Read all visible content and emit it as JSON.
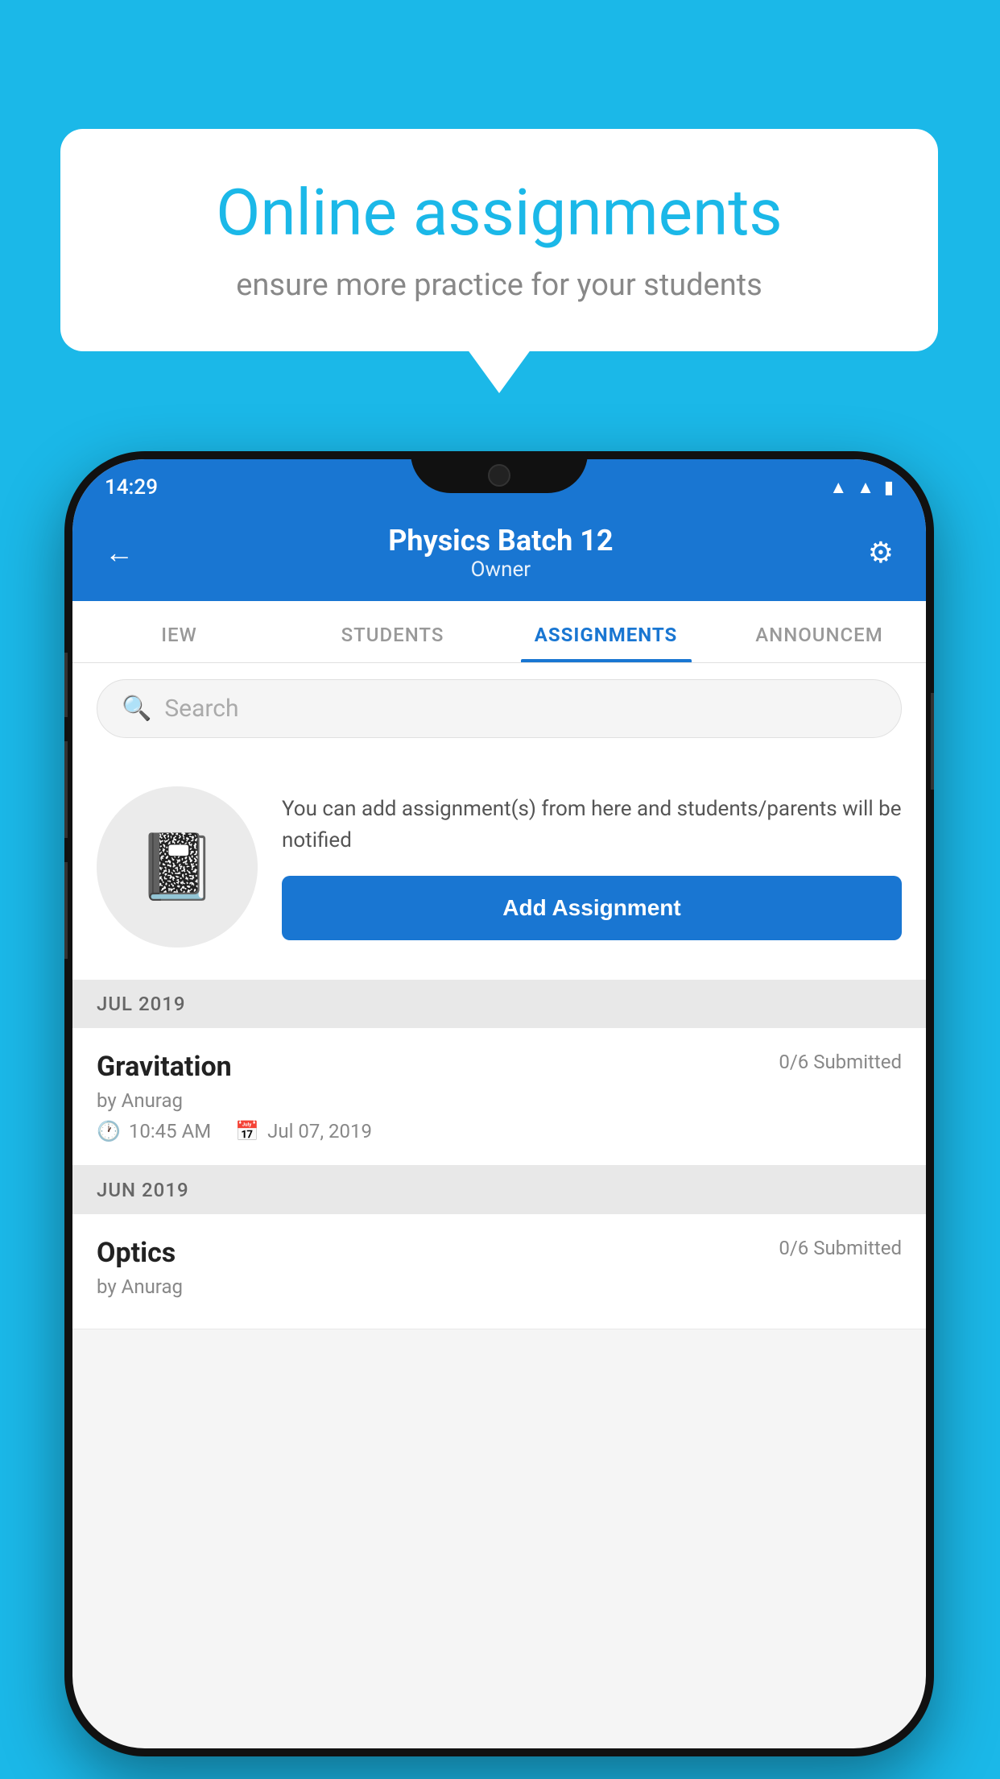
{
  "background": {
    "color": "#1bb8e8"
  },
  "speech_bubble": {
    "title": "Online assignments",
    "subtitle": "ensure more practice for your students"
  },
  "phone": {
    "status_bar": {
      "time": "14:29",
      "icons": [
        "wifi",
        "signal",
        "battery"
      ]
    },
    "header": {
      "back_label": "←",
      "title": "Physics Batch 12",
      "subtitle": "Owner",
      "settings_label": "⚙"
    },
    "tabs": [
      {
        "label": "IEW",
        "active": false
      },
      {
        "label": "STUDENTS",
        "active": false
      },
      {
        "label": "ASSIGNMENTS",
        "active": true
      },
      {
        "label": "ANNOUNCEM",
        "active": false
      }
    ],
    "search": {
      "placeholder": "Search"
    },
    "promo": {
      "description": "You can add assignment(s) from here and students/parents will be notified",
      "button_label": "Add Assignment"
    },
    "sections": [
      {
        "month": "JUL 2019",
        "assignments": [
          {
            "name": "Gravitation",
            "submitted": "0/6 Submitted",
            "by": "by Anurag",
            "time": "10:45 AM",
            "date": "Jul 07, 2019"
          }
        ]
      },
      {
        "month": "JUN 2019",
        "assignments": [
          {
            "name": "Optics",
            "submitted": "0/6 Submitted",
            "by": "by Anurag",
            "time": "",
            "date": ""
          }
        ]
      }
    ]
  }
}
